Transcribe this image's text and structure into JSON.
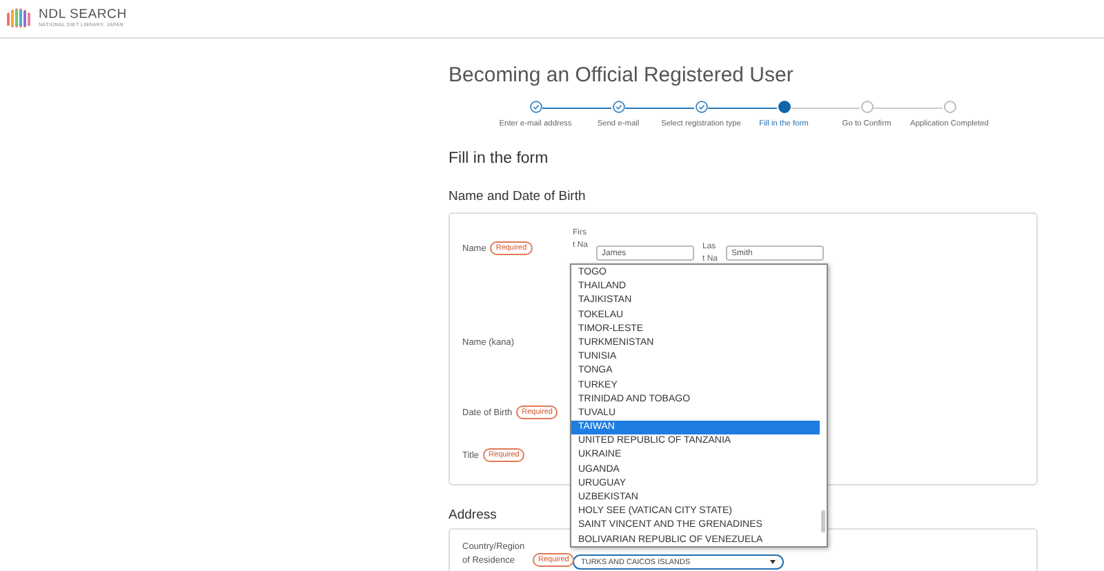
{
  "header": {
    "logo_title": "NDL SEARCH",
    "logo_subtitle": "NATIONAL DIET LIBRARY, JAPAN"
  },
  "page_title": "Becoming an Official Registered User",
  "steps": [
    {
      "label": "Enter e-mail address",
      "completed": true,
      "selected": false
    },
    {
      "label": "Send e-mail",
      "completed": true,
      "selected": false
    },
    {
      "label": "Select registration type",
      "completed": true,
      "selected": false
    },
    {
      "label": "Fill in the form",
      "completed": false,
      "selected": true
    },
    {
      "label": "Go to Confirm",
      "completed": false,
      "selected": false
    },
    {
      "label": "Application Completed",
      "completed": false,
      "selected": false
    }
  ],
  "form_heading": "Fill in the form",
  "name_section": {
    "heading": "Name and Date of Birth",
    "rows": [
      {
        "kind": "name",
        "label": "Name",
        "required": true,
        "badge": "Required",
        "fields": [
          {
            "label": "First Na",
            "value": "James"
          },
          {
            "label": "Last Na",
            "value": "Smith"
          }
        ]
      },
      {
        "kind": "plain",
        "label": "Name (kana)",
        "required": false
      },
      {
        "kind": "plain",
        "label": "Date of Birth",
        "required": true,
        "badge": "Required"
      },
      {
        "kind": "plain",
        "label": "Title",
        "required": true,
        "badge": "Required"
      }
    ]
  },
  "address_section": {
    "heading": "Address",
    "country": {
      "label": "Country/Region of Residence",
      "required": true,
      "badge": "Required",
      "value": "TURKS AND CAICOS ISLANDS"
    }
  },
  "dropdown_options": [
    {
      "label": "TOGO",
      "selected": false
    },
    {
      "label": "THAILAND",
      "selected": false
    },
    {
      "label": "TAJIKISTAN",
      "selected": false
    },
    {
      "label": "TOKELAU",
      "selected": false
    },
    {
      "label": "TIMOR-LESTE",
      "selected": false
    },
    {
      "label": "TURKMENISTAN",
      "selected": false
    },
    {
      "label": "TUNISIA",
      "selected": false
    },
    {
      "label": "TONGA",
      "selected": false
    },
    {
      "label": "TURKEY",
      "selected": false
    },
    {
      "label": "TRINIDAD AND TOBAGO",
      "selected": false
    },
    {
      "label": "TUVALU",
      "selected": false
    },
    {
      "label": "TAIWAN",
      "selected": true
    },
    {
      "label": "UNITED REPUBLIC OF TANZANIA",
      "selected": false
    },
    {
      "label": "UKRAINE",
      "selected": false
    },
    {
      "label": "UGANDA",
      "selected": false
    },
    {
      "label": "URUGUAY",
      "selected": false
    },
    {
      "label": "UZBEKISTAN",
      "selected": false
    },
    {
      "label": "HOLY SEE (VATICAN CITY STATE)",
      "selected": false
    },
    {
      "label": "SAINT VINCENT AND THE GRENADINES",
      "selected": false
    },
    {
      "label": "BOLIVARIAN REPUBLIC OF VENEZUELA",
      "selected": false
    }
  ]
}
